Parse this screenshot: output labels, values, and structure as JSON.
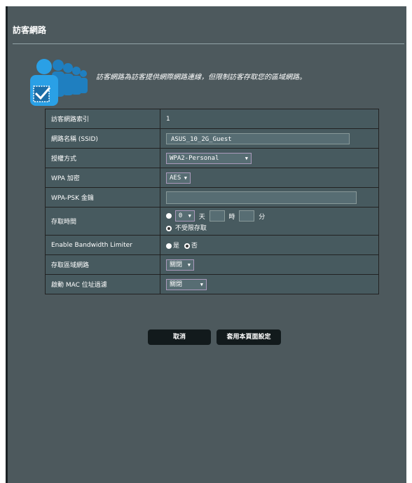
{
  "title": "訪客網路",
  "intro": "訪客網路為訪客提供網際網路連線，但限制訪客存取您的區域網路。",
  "rows": {
    "index": {
      "label": "訪客網路索引",
      "value": "1"
    },
    "ssid": {
      "label": "網路名稱 (SSID)",
      "value": "ASUS_10_2G_Guest"
    },
    "auth": {
      "label": "授權方式",
      "value": "WPA2-Personal"
    },
    "enc": {
      "label": "WPA 加密",
      "value": "AES"
    },
    "psk": {
      "label": "WPA-PSK 金鑰",
      "value": ""
    },
    "access_time": {
      "label": "存取時間",
      "days": "0",
      "day_unit": "天",
      "hour_unit": "時",
      "min_unit": "分",
      "unlimited": "不受限存取"
    },
    "bw": {
      "label": "Enable Bandwidth Limiter",
      "yes": "是",
      "no": "否"
    },
    "intranet": {
      "label": "存取區域網路",
      "value": "關閉"
    },
    "mac": {
      "label": "啟動 MAC 位址過濾",
      "value": "關閉"
    }
  },
  "buttons": {
    "cancel": "取消",
    "apply": "套用本頁面設定"
  },
  "colors": {
    "panel": "#4d595d",
    "button": "#121a1c",
    "icon": "#1a8fd0"
  },
  "icon": "guest-users-icon"
}
